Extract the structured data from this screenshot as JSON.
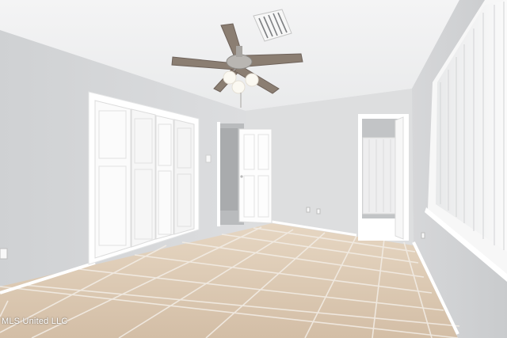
{
  "photo": {
    "subject": "empty-bedroom",
    "colors": {
      "wall": "#dcdddf",
      "ceiling": "#f3f3f4",
      "floor": "#d9c5ae",
      "trim": "#ffffff"
    }
  },
  "watermark": {
    "text": "MLS United LLC"
  }
}
